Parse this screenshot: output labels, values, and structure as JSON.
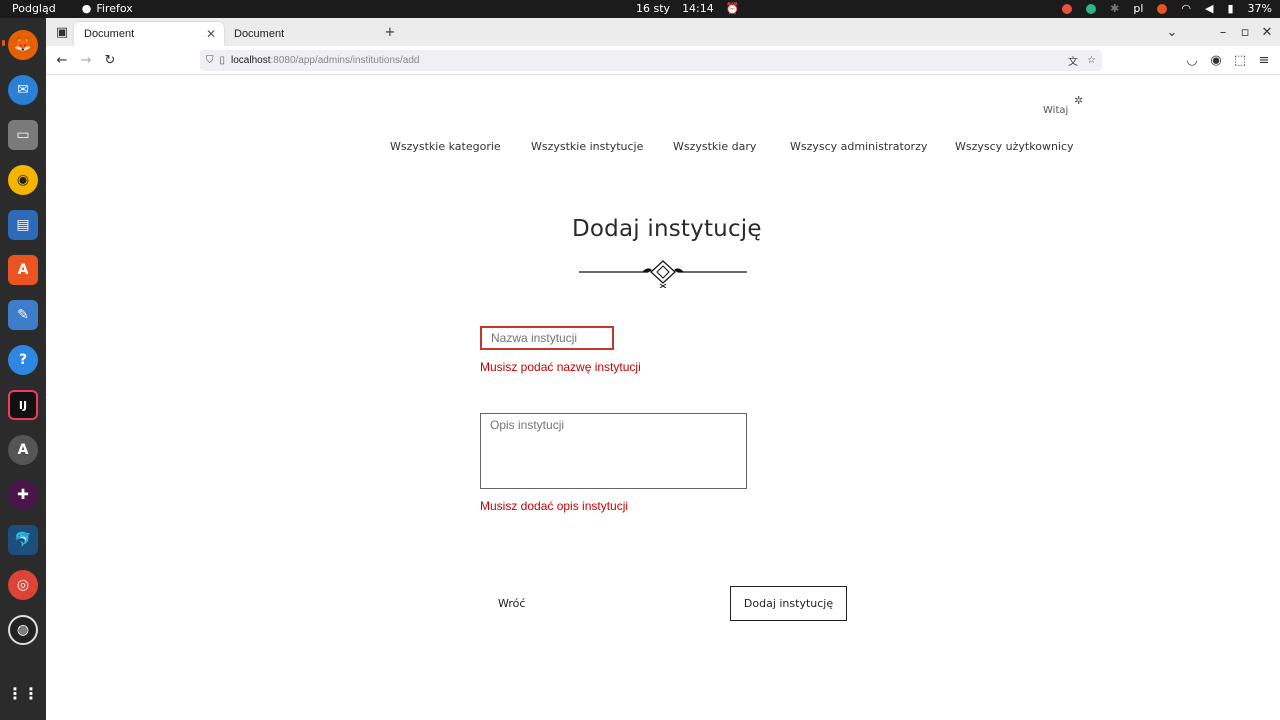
{
  "system": {
    "activities": "Podgląd",
    "app_name": "Firefox",
    "date": "16 sty",
    "time": "14:14",
    "language": "pl",
    "battery": "37%"
  },
  "browser": {
    "tabs": [
      {
        "label": "Document",
        "active": true
      },
      {
        "label": "Document",
        "active": false
      }
    ],
    "url_host": "localhost",
    "url_path": ":8080/app/admins/institutions/add"
  },
  "page": {
    "welcome": "Witaj",
    "menu": [
      "Wszystkie kategorie",
      "Wszystkie instytucje",
      "Wszystkie dary",
      "Wszyscy administratorzy",
      "Wszyscy użytkownicy"
    ],
    "title": "Dodaj instytucję",
    "name_placeholder": "Nazwa instytucji",
    "name_error": "Musisz podać nazwę instytucji",
    "desc_placeholder": "Opis instytucji",
    "desc_error": "Musisz dodać opis instytucji",
    "back_label": "Wróć",
    "submit_label": "Dodaj instytucję"
  },
  "colors": {
    "error": "#cc0000",
    "invalid_border": "#c0392b",
    "accent": "#e95420"
  }
}
